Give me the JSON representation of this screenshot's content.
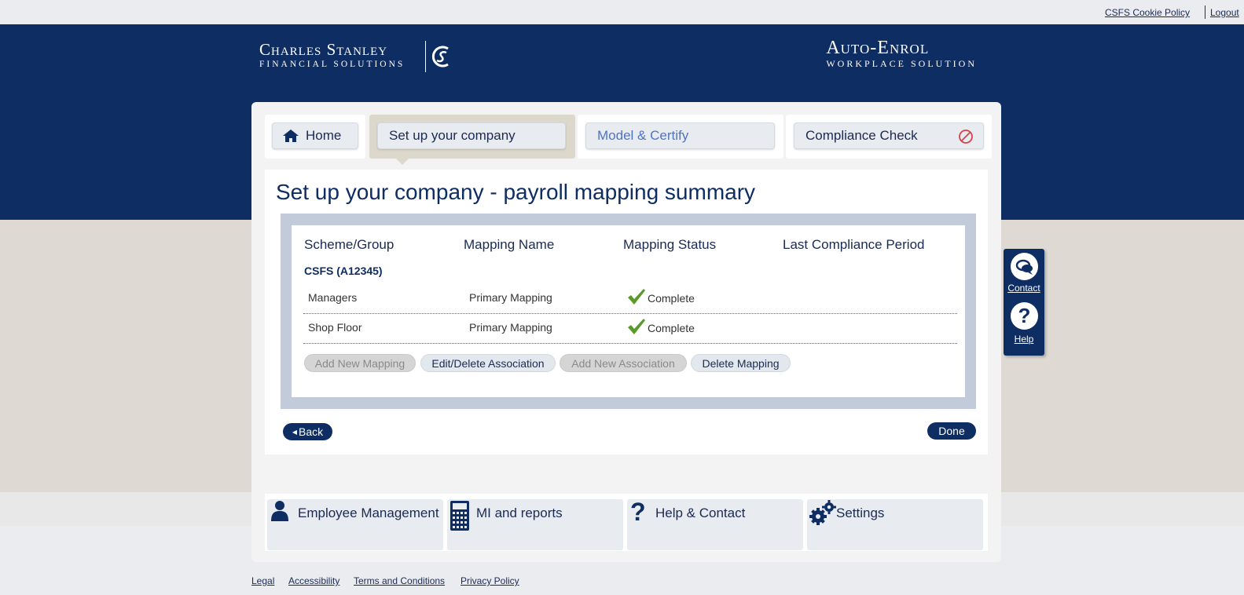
{
  "topbar": {
    "cookie_policy": "CSFS Cookie Policy",
    "logout": "Logout"
  },
  "branding": {
    "company_line1": "Charles Stanley",
    "company_line2": "Financial Solutions",
    "product_line1": "Auto-Enrol",
    "product_line2": "Workplace Solution"
  },
  "tabs": {
    "home": "Home",
    "setup": "Set up your company",
    "model": "Model & Certify",
    "compliance": "Compliance Check"
  },
  "page_title": "Set up your company - payroll mapping summary",
  "table": {
    "headers": [
      "Scheme/Group",
      "Mapping Name",
      "Mapping Status",
      "Last Compliance Period"
    ],
    "group": "CSFS (A12345)",
    "rows": [
      {
        "scheme": "Managers",
        "mapping": "Primary Mapping",
        "status": "Complete",
        "period": ""
      },
      {
        "scheme": "Shop Floor",
        "mapping": "Primary Mapping",
        "status": "Complete",
        "period": ""
      }
    ]
  },
  "actions": {
    "add_mapping": "Add New Mapping",
    "edit_association": "Edit/Delete Association",
    "add_association": "Add New Association",
    "delete_mapping": "Delete Mapping"
  },
  "nav": {
    "back": "Back",
    "done": "Done"
  },
  "side": {
    "contact": "Contact",
    "help": "Help"
  },
  "quick_links": {
    "employee": "Employee Management",
    "mi": "MI and reports",
    "help": "Help & Contact",
    "settings": "Settings"
  },
  "footer": {
    "legal": "Legal",
    "accessibility": "Accessibility",
    "terms": "Terms and Conditions",
    "privacy": "Privacy Policy"
  },
  "colors": {
    "navy": "#0e2d63",
    "beige": "#dedad3",
    "check_green": "#5a9a2a",
    "no_entry_red": "#d9424a"
  }
}
